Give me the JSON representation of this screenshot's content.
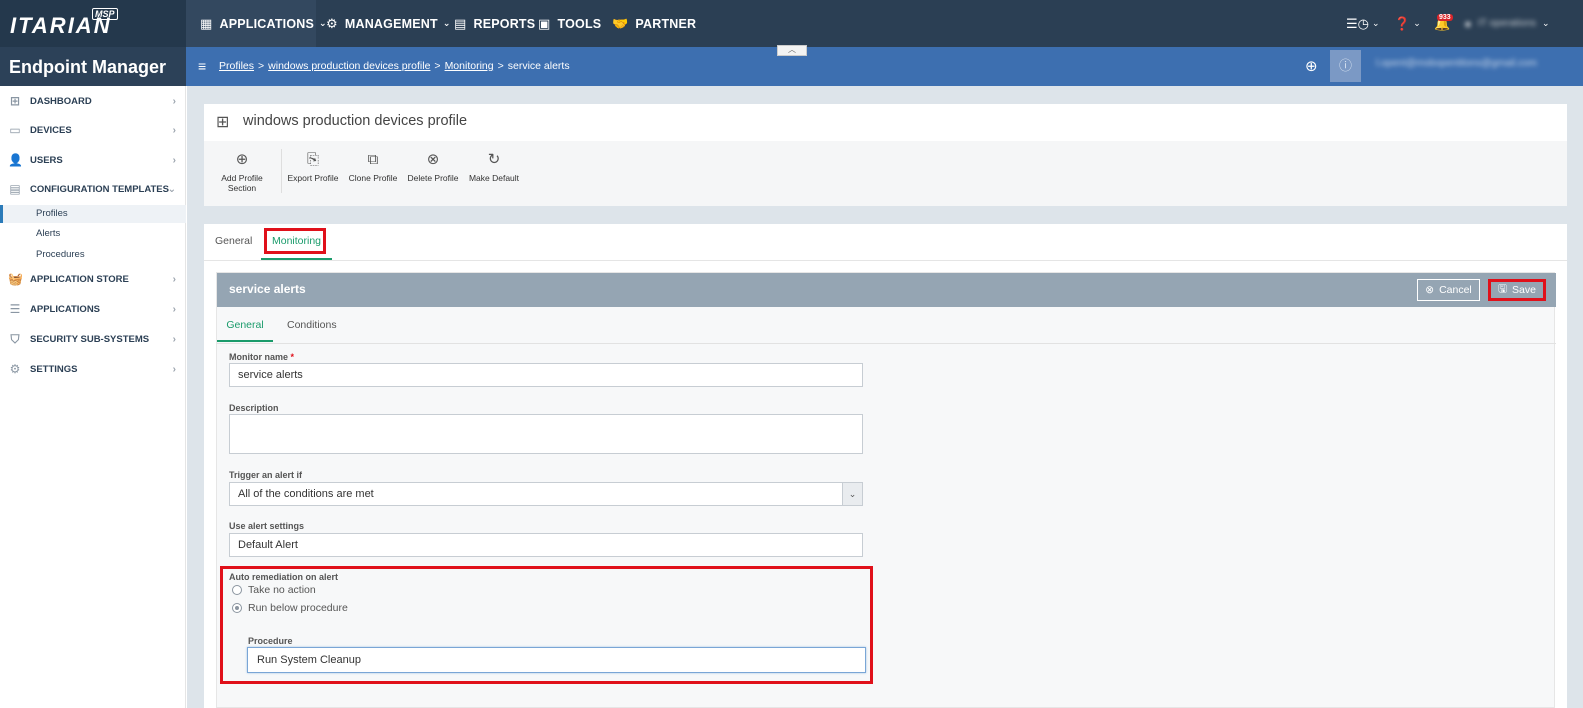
{
  "topbar": {
    "brand": "ITARIAN",
    "brand_tag": "MSP",
    "nav": [
      {
        "label": "APPLICATIONS",
        "icon": "grid-icon"
      },
      {
        "label": "MANAGEMENT",
        "icon": "gears-icon"
      },
      {
        "label": "REPORTS",
        "icon": "report-icon"
      },
      {
        "label": "TOOLS",
        "icon": "toolbox-icon"
      },
      {
        "label": "PARTNER",
        "icon": "handshake-icon"
      }
    ],
    "notification_count": "933",
    "user_name": "IT operations"
  },
  "header": {
    "app_title": "Endpoint Manager",
    "breadcrumb": [
      "Profiles",
      "windows production devices profile",
      "Monitoring",
      "service alerts"
    ],
    "user_email": "l.opent@msbopentitons@gmail.com"
  },
  "sidebar": {
    "items": [
      {
        "label": "DASHBOARD",
        "icon": "dashboard-icon"
      },
      {
        "label": "DEVICES",
        "icon": "devices-icon"
      },
      {
        "label": "USERS",
        "icon": "user-icon"
      },
      {
        "label": "CONFIGURATION TEMPLATES",
        "icon": "templates-icon"
      },
      {
        "label": "APPLICATION STORE",
        "icon": "basket-icon"
      },
      {
        "label": "APPLICATIONS",
        "icon": "applications-icon"
      },
      {
        "label": "SECURITY SUB-SYSTEMS",
        "icon": "shield-icon"
      },
      {
        "label": "SETTINGS",
        "icon": "gear-icon"
      }
    ],
    "sub_items": [
      "Profiles",
      "Alerts",
      "Procedures"
    ]
  },
  "profile": {
    "title": "windows production devices profile",
    "toolbar": [
      {
        "label": "Add Profile Section",
        "label_line1": "Add Profile",
        "label_line2": "Section"
      },
      {
        "label": "Export Profile"
      },
      {
        "label": "Clone Profile"
      },
      {
        "label": "Delete Profile"
      },
      {
        "label": "Make Default"
      }
    ],
    "tabs": [
      "General",
      "Monitoring"
    ]
  },
  "panel": {
    "title": "service alerts",
    "cancel_label": "Cancel",
    "save_label": "Save",
    "subtabs": [
      "General",
      "Conditions"
    ],
    "fields": {
      "monitor_name_label": "Monitor name",
      "monitor_name_required": "*",
      "monitor_name_value": "service alerts",
      "description_label": "Description",
      "description_value": "",
      "trigger_label": "Trigger an alert if",
      "trigger_value": "All of the conditions are met",
      "alert_settings_label": "Use alert settings",
      "alert_settings_value": "Default Alert",
      "remediation_label": "Auto remediation on alert",
      "remediation_options": [
        "Take no action",
        "Run below procedure"
      ],
      "remediation_selected": "Run below procedure",
      "procedure_label": "Procedure",
      "procedure_value": "Run System Cleanup"
    }
  }
}
